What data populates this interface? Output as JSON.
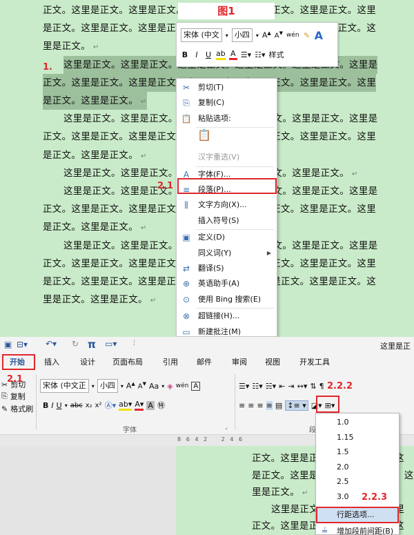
{
  "doc": {
    "lines": [
      {
        "text": "正文。这里是正文。这里是正文。这里是正文。这里是正文。这里是正文。这里",
        "indent": 62,
        "hl": false,
        "ret": false
      },
      {
        "text": "是正文。这里是正文。这里是正文。这里是正文。这里是正文。这里是正文。这",
        "indent": 62,
        "hl": false,
        "ret": false
      },
      {
        "text": "里是正文。",
        "indent": 62,
        "hl": false,
        "ret": true
      },
      {
        "text": "这里是正文。这里是正文。这里是正文。这里是正文。这里是正文。这里是",
        "indent": 92,
        "hl": true,
        "ret": false
      },
      {
        "text": "正文。这里是正文。这里是正文。这里是正文。这里是正文。这里是正文。这里",
        "indent": 62,
        "hl": true,
        "ret": false
      },
      {
        "text": "是正文。这里是正文。",
        "indent": 62,
        "hl": true,
        "ret": true
      },
      {
        "text": "这里是正文。这里是正文。这里是正文。这里是正文。这里是正文。这里是",
        "indent": 92,
        "hl": false,
        "ret": false
      },
      {
        "text": "正文。这里是正文。这里是正文。这里是正文。这里是正文。这里是正文。这里",
        "indent": 62,
        "hl": false,
        "ret": false
      },
      {
        "text": "是正文。这里是正文。",
        "indent": 62,
        "hl": false,
        "ret": true
      },
      {
        "text": "这里是正文。这里是正文。这里是正文。这里是正文。这里是正文。",
        "indent": 92,
        "hl": false,
        "ret": true
      },
      {
        "text": "这里是正文。这里是正文。这里是正文。这里是正文。这里是正文。这里是",
        "indent": 92,
        "hl": false,
        "ret": false
      },
      {
        "text": "正文。这里是正文。这里是正文。这里是正文。这里是正文。这里是正文。这里",
        "indent": 62,
        "hl": false,
        "ret": false
      },
      {
        "text": "是正文。这里是正文。",
        "indent": 62,
        "hl": false,
        "ret": true
      },
      {
        "text": "这里是正文。这里是正文。这里是正文。这里是正文。这里是正文。这里是",
        "indent": 92,
        "hl": false,
        "ret": false
      },
      {
        "text": "正文。这里是正文。这里是正文。这里是正文。这里是正文。这里是正文。这里",
        "indent": 62,
        "hl": false,
        "ret": false
      },
      {
        "text": "是正文。这里是正文。这里是正文。这里是正文。这里是正文。这里是正文。这",
        "indent": 62,
        "hl": false,
        "ret": false
      },
      {
        "text": "里是正文。这里是正文。",
        "indent": 62,
        "hl": false,
        "ret": true
      }
    ],
    "return_mark": "↵"
  },
  "figure_label": "图1",
  "annotations": {
    "a1": "1.",
    "a21": "2.1",
    "a21b": "2.1",
    "a222": "2.2.2",
    "a223": "2.2.3"
  },
  "minibar": {
    "font": "宋体 (中文",
    "size": "小四",
    "grow": "A",
    "shrink": "A",
    "phonetic": "wén",
    "styles": "样式",
    "bold": "B",
    "italic": "I",
    "underline": "U"
  },
  "context_menu": {
    "items": [
      {
        "icon": "✂",
        "label": "剪切(T)",
        "disabled": false,
        "sub": false
      },
      {
        "icon": "⎘",
        "label": "复制(C)",
        "disabled": false,
        "sub": false
      },
      {
        "icon": "📋",
        "label": "粘贴选项:",
        "disabled": false,
        "sub": false
      },
      {
        "icon": "",
        "label": "",
        "disabled": false,
        "sub": false
      },
      {
        "icon": "",
        "label": "汉字重选(V)",
        "disabled": true,
        "sub": false
      },
      {
        "icon": "A",
        "label": "字体(F)...",
        "disabled": false,
        "sub": false
      },
      {
        "icon": "≡",
        "label": "段落(P)...",
        "disabled": false,
        "sub": false
      },
      {
        "icon": "⫼",
        "label": "文字方向(X)...",
        "disabled": false,
        "sub": false
      },
      {
        "icon": "",
        "label": "插入符号(S)",
        "disabled": false,
        "sub": false
      },
      {
        "icon": "▣",
        "label": "定义(D)",
        "disabled": false,
        "sub": false
      },
      {
        "icon": "",
        "label": "同义词(Y)",
        "disabled": false,
        "sub": true
      },
      {
        "icon": "⇄",
        "label": "翻译(S)",
        "disabled": false,
        "sub": false
      },
      {
        "icon": "⊕",
        "label": "英语助手(A)",
        "disabled": false,
        "sub": false
      },
      {
        "icon": "⊙",
        "label": "使用 Bing 搜索(E)",
        "disabled": false,
        "sub": false
      },
      {
        "icon": "⊗",
        "label": "超链接(H)...",
        "disabled": false,
        "sub": false
      },
      {
        "icon": "▭",
        "label": "新建批注(M)",
        "disabled": false,
        "sub": false
      }
    ]
  },
  "ribbon": {
    "title_right": "这里是正",
    "tabs": [
      "开始",
      "插入",
      "设计",
      "页面布局",
      "引用",
      "邮件",
      "审阅",
      "视图",
      "开发工具"
    ],
    "clipboard": {
      "cut": "剪切",
      "copy": "复制",
      "painter": "格式刷"
    },
    "font_name": "宋体 (中文正",
    "font_size": "小四",
    "font_group": "字体",
    "para_group": "段",
    "aa": "Aa",
    "ruler_ticks": "8   6   4   2        2   4   6"
  },
  "doc2": {
    "lines": [
      {
        "text": "正文。这里是正文。这里是正文。这",
        "indent": 365,
        "ret": false
      },
      {
        "text": "是正文。这里是正文。这里是正文。这",
        "indent": 365,
        "ret": false
      },
      {
        "text": "里是正文。",
        "indent": 365,
        "ret": true
      },
      {
        "text": "这里是正文。这里是正文。这里",
        "indent": 393,
        "ret": false
      },
      {
        "text": "正文。这里是正文。这里是正文。这",
        "indent": 365,
        "ret": false
      }
    ]
  },
  "spacing_menu": {
    "items": [
      "1.0",
      "1.15",
      "1.5",
      "2.0",
      "2.5",
      "3.0"
    ],
    "options": "行距选项...",
    "add_before": "增加段前间距(B)"
  }
}
